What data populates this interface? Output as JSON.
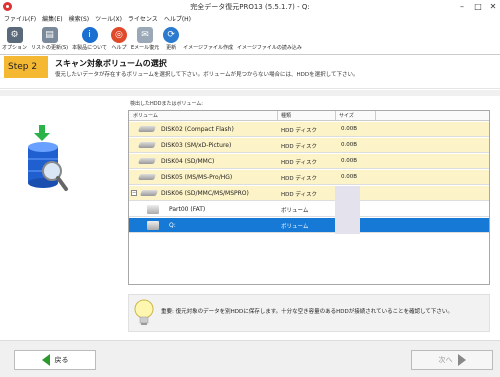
{
  "window": {
    "title": "完全データ復元PRO13 (5.5.1.7) - Q:",
    "min": "–",
    "max": "□",
    "close": "✕"
  },
  "menu": [
    "ファイル(F)",
    "編集(E)",
    "検索(S)",
    "ツール(X)",
    "ライセンス",
    "ヘルプ(H)"
  ],
  "toolbar": [
    {
      "label": "オプション",
      "icon": "options-icon",
      "color": "#5a6a7a",
      "glyph": "⚙"
    },
    {
      "label": "リストの更新(S)",
      "icon": "refresh-list-icon",
      "color": "#7a8a9a",
      "glyph": "▤"
    },
    {
      "label": "本製品について",
      "icon": "info-icon",
      "color": "#1a6fd0",
      "glyph": "i"
    },
    {
      "label": "ヘルプ",
      "icon": "help-lifebuoy-icon",
      "color": "#e04a2a",
      "glyph": "◎"
    },
    {
      "label": "Eメール復元",
      "icon": "email-icon",
      "color": "#9aa8b8",
      "glyph": "✉"
    },
    {
      "label": "更新",
      "icon": "update-icon",
      "color": "#2a7ad0",
      "glyph": "⟳"
    },
    {
      "label": "イメージファイル作成",
      "icon": "",
      "color": "",
      "glyph": ""
    },
    {
      "label": "イメージファイルの読み込み",
      "icon": "",
      "color": "",
      "glyph": ""
    }
  ],
  "step": {
    "tag": "Step 2",
    "title": "スキャン対象ボリュームの選択",
    "description": "復元したいデータが存在するボリュームを選択して下さい。ボリュームが見つからない場合には、HDDを選択して下さい。"
  },
  "list": {
    "label": "検出したHDDまたはボリューム:",
    "columns": [
      "ボリューム",
      "種類",
      "サイズ"
    ],
    "rows": [
      {
        "name": "DISK02 (Compact Flash)",
        "kind": "HDD ディスク",
        "size": "0.00B"
      },
      {
        "name": "DISK03 (SM/xD-Picture)",
        "kind": "HDD ディスク",
        "size": "0.00B"
      },
      {
        "name": "DISK04 (SD/MMC)",
        "kind": "HDD ディスク",
        "size": "0.00B"
      },
      {
        "name": "DISK05 (MS/MS-Pro/HG)",
        "kind": "HDD ディスク",
        "size": "0.00B"
      },
      {
        "name": "DISK06 (SD/MMC/MS/MSPRO)",
        "kind": "HDD ディスク",
        "size": "",
        "expand": "−"
      },
      {
        "name": "Part00 (FAT)",
        "kind": "ボリューム",
        "size": ""
      },
      {
        "name": "Q:",
        "kind": "ボリューム",
        "size": ""
      }
    ]
  },
  "note": {
    "text": "重要: 復元対象のデータを別HDDに保存します。十分な空き容量のあるHDDが接続されていることを確認して下さい。"
  },
  "footer": {
    "back": "戻る",
    "next": "次へ"
  },
  "colors": {
    "step_tag": "#f4b833",
    "disk_row": "#fdf3c8",
    "selected_row": "#1679d6"
  }
}
